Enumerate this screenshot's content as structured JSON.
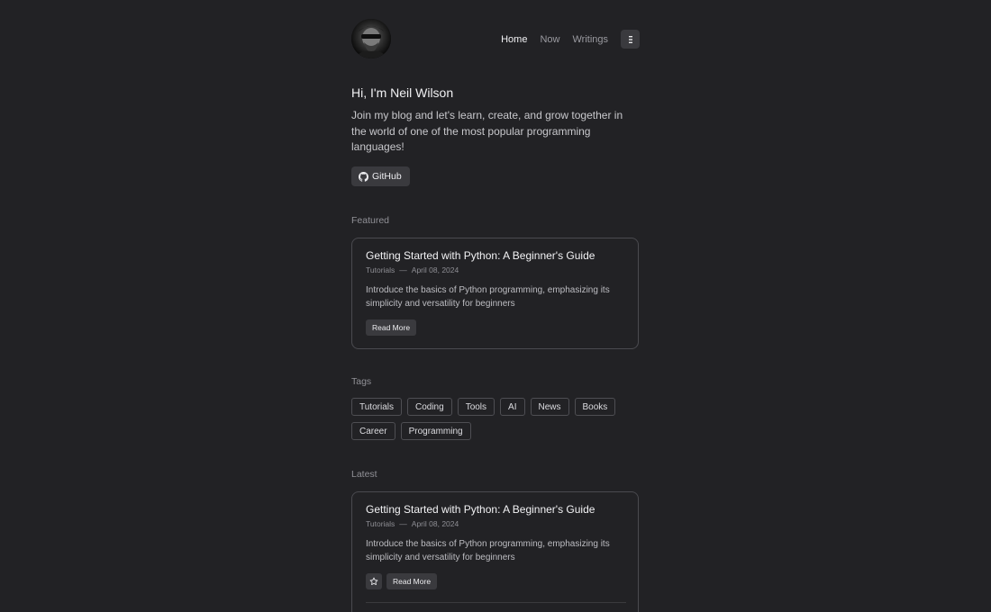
{
  "nav": {
    "items": [
      "Home",
      "Now",
      "Writings"
    ]
  },
  "intro": {
    "title": "Hi, I'm Neil Wilson",
    "text": "Join my blog and let's learn, create, and grow together in the world of one of the most popular programming languages!",
    "github_label": "GitHub"
  },
  "featured": {
    "label": "Featured",
    "post": {
      "title": "Getting Started with Python: A Beginner's Guide",
      "category": "Tutorials",
      "sep": "—",
      "date": "April 08, 2024",
      "description": "Introduce the basics of Python programming, emphasizing its simplicity and versatility for beginners",
      "button": "Read More"
    }
  },
  "tags": {
    "label": "Tags",
    "items": [
      "Tutorials",
      "Coding",
      "Tools",
      "AI",
      "News",
      "Books",
      "Career",
      "Programming"
    ]
  },
  "latest": {
    "label": "Latest",
    "post": {
      "title": "Getting Started with Python: A Beginner's Guide",
      "category": "Tutorials",
      "sep": "—",
      "date": "April 08, 2024",
      "description": "Introduce the basics of Python programming, emphasizing its simplicity and versatility for beginners",
      "button": "Read More"
    }
  },
  "icons": {
    "avatar": "avatar-photo",
    "menu": "menu-dots-icon",
    "github": "github-icon",
    "star": "star-icon"
  },
  "colors": {
    "background": "#222225",
    "button": "#3a3a3e",
    "border": "#4a4a4f",
    "text": "#e8e8ea",
    "muted": "#909096"
  }
}
